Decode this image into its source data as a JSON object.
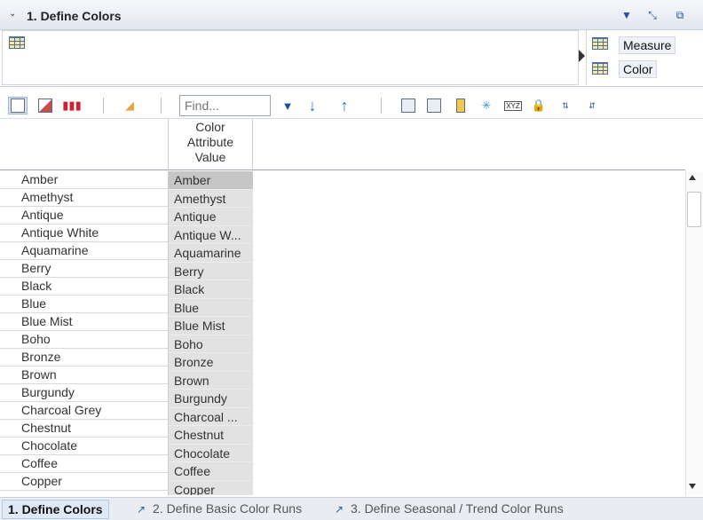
{
  "title": "1. Define Colors",
  "upper_tiles": [
    {
      "label": "Measure"
    },
    {
      "label": "Color"
    }
  ],
  "toolbar": {
    "find_placeholder": "Find..."
  },
  "grid": {
    "column_header": "Color Attribute Value",
    "rows": [
      {
        "label": "Amber",
        "value": "Amber"
      },
      {
        "label": "Amethyst",
        "value": "Amethyst"
      },
      {
        "label": "Antique",
        "value": "Antique"
      },
      {
        "label": "Antique White",
        "value": "Antique W..."
      },
      {
        "label": "Aquamarine",
        "value": "Aquamarine"
      },
      {
        "label": "Berry",
        "value": "Berry"
      },
      {
        "label": "Black",
        "value": "Black"
      },
      {
        "label": "Blue",
        "value": "Blue"
      },
      {
        "label": "Blue Mist",
        "value": "Blue Mist"
      },
      {
        "label": "Boho",
        "value": "Boho"
      },
      {
        "label": "Bronze",
        "value": "Bronze"
      },
      {
        "label": "Brown",
        "value": "Brown"
      },
      {
        "label": "Burgundy",
        "value": "Burgundy"
      },
      {
        "label": "Charcoal Grey",
        "value": "Charcoal ..."
      },
      {
        "label": "Chestnut",
        "value": "Chestnut"
      },
      {
        "label": "Chocolate",
        "value": "Chocolate"
      },
      {
        "label": "Coffee",
        "value": "Coffee"
      },
      {
        "label": "Copper",
        "value": "Copper"
      }
    ]
  },
  "tabs": [
    {
      "label": "1. Define Colors",
      "active": true
    },
    {
      "label": "2. Define Basic Color Runs",
      "active": false
    },
    {
      "label": "3. Define Seasonal / Trend Color Runs",
      "active": false
    }
  ],
  "colors": {
    "accent": "#1d4fa3",
    "active_tab_bg": "#dfe9f6",
    "cell_bg": "#e2e2e2"
  }
}
